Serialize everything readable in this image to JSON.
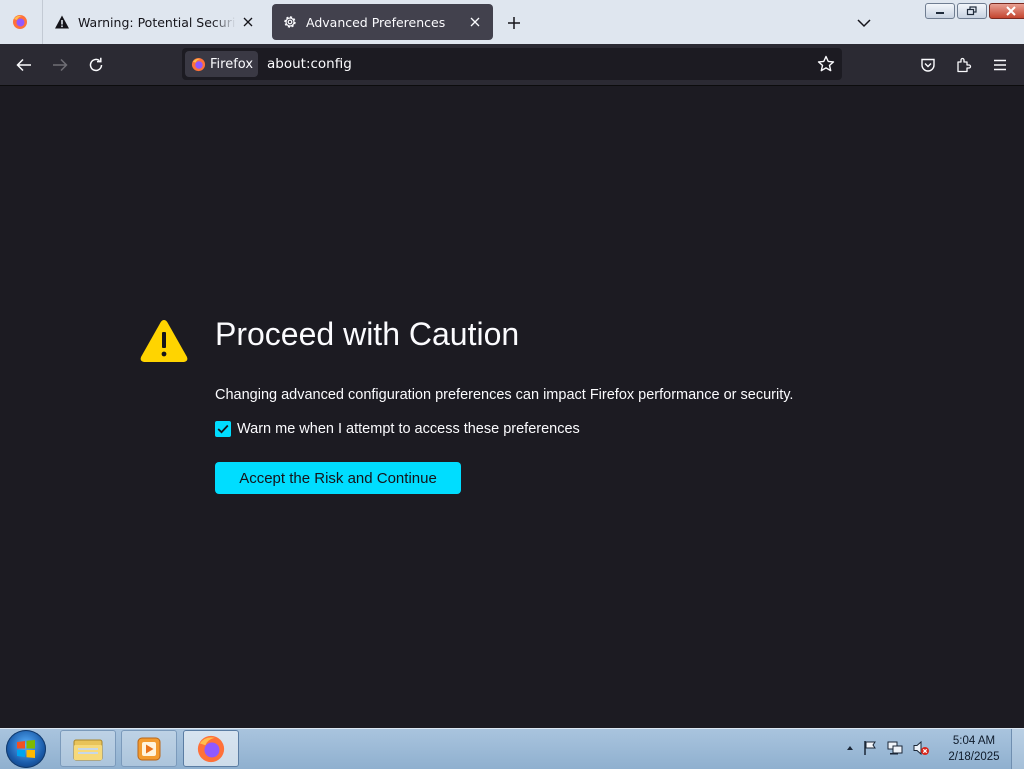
{
  "browser": {
    "tabs": [
      {
        "title": "Warning: Potential Security Risk Ahead",
        "icon": "warning-icon",
        "active": false
      },
      {
        "title": "Advanced Preferences",
        "icon": "gear-icon",
        "active": true
      }
    ],
    "identity_label": "Firefox",
    "url": "about:config"
  },
  "page": {
    "heading": "Proceed with Caution",
    "description": "Changing advanced configuration preferences can impact Firefox performance or security.",
    "checkbox_label": "Warn me when I attempt to access these preferences",
    "checkbox_checked": true,
    "accept_button": "Accept the Risk and Continue"
  },
  "colors": {
    "accent": "#00ddff",
    "page_background": "#1c1b22",
    "warning_yellow": "#ffd400"
  },
  "taskbar": {
    "items": [
      "file-explorer-icon",
      "media-player-icon",
      "firefox-icon"
    ],
    "active_item": "firefox-icon",
    "tray_icons": [
      "show-hidden-icons-arrow",
      "action-center-flag-icon",
      "network-icon",
      "volume-muted-icon"
    ],
    "time": "5:04 AM",
    "date": "2/18/2025"
  }
}
